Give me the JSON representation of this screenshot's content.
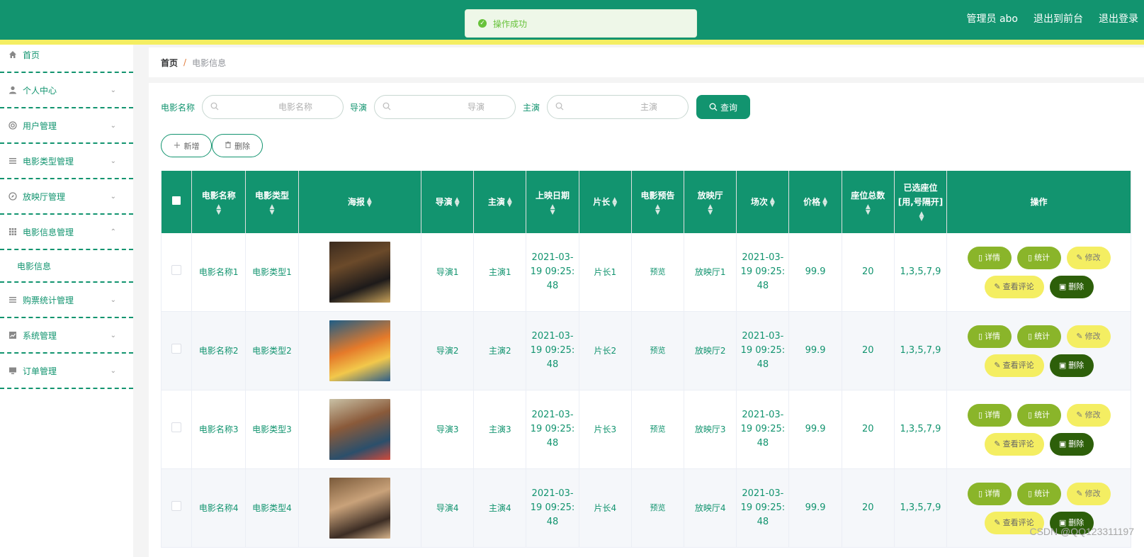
{
  "header": {
    "admin_label": "管理员 abo",
    "to_frontend": "退出到前台",
    "logout": "退出登录",
    "toast": "操作成功"
  },
  "sidebar": {
    "items": [
      {
        "label": "首页",
        "icon": "home-icon"
      },
      {
        "label": "个人中心",
        "icon": "user-icon"
      },
      {
        "label": "用户管理",
        "icon": "lifebuoy-icon"
      },
      {
        "label": "电影类型管理",
        "icon": "list-icon"
      },
      {
        "label": "放映厅管理",
        "icon": "compass-icon"
      },
      {
        "label": "电影信息管理",
        "icon": "grid-icon"
      },
      {
        "label": "购票统计管理",
        "icon": "list-icon"
      },
      {
        "label": "系统管理",
        "icon": "chart-icon"
      },
      {
        "label": "订单管理",
        "icon": "monitor-icon"
      }
    ],
    "submenu_item": "电影信息"
  },
  "breadcrumb": {
    "home": "首页",
    "sep": "/",
    "current": "电影信息"
  },
  "search": {
    "name_label": "电影名称",
    "name_placeholder": "电影名称",
    "director_label": "导演",
    "director_placeholder": "导演",
    "actor_label": "主演",
    "actor_placeholder": "主演",
    "query_button": "查询"
  },
  "actions": {
    "add": "新增",
    "delete": "删除"
  },
  "table": {
    "headers": [
      "电影名称",
      "电影类型",
      "海报",
      "导演",
      "主演",
      "上映日期",
      "片长",
      "电影预告",
      "放映厅",
      "场次",
      "价格",
      "座位总数",
      "已选座位[用,号隔开]",
      "操作"
    ],
    "rows": [
      {
        "name": "电影名称1",
        "type": "电影类型1",
        "director": "导演1",
        "actor": "主演1",
        "release": "2021-03-19 09:25:48",
        "length": "片长1",
        "trailer": "预览",
        "hall": "放映厅1",
        "session": "2021-03-19 09:25:48",
        "price": "99.9",
        "seats": "20",
        "selected": "1,3,5,7,9"
      },
      {
        "name": "电影名称2",
        "type": "电影类型2",
        "director": "导演2",
        "actor": "主演2",
        "release": "2021-03-19 09:25:48",
        "length": "片长2",
        "trailer": "预览",
        "hall": "放映厅2",
        "session": "2021-03-19 09:25:48",
        "price": "99.9",
        "seats": "20",
        "selected": "1,3,5,7,9"
      },
      {
        "name": "电影名称3",
        "type": "电影类型3",
        "director": "导演3",
        "actor": "主演3",
        "release": "2021-03-19 09:25:48",
        "length": "片长3",
        "trailer": "预览",
        "hall": "放映厅3",
        "session": "2021-03-19 09:25:48",
        "price": "99.9",
        "seats": "20",
        "selected": "1,3,5,7,9"
      },
      {
        "name": "电影名称4",
        "type": "电影类型4",
        "director": "导演4",
        "actor": "主演4",
        "release": "2021-03-19 09:25:48",
        "length": "片长4",
        "trailer": "预览",
        "hall": "放映厅4",
        "session": "2021-03-19 09:25:48",
        "price": "99.9",
        "seats": "20",
        "selected": "1,3,5,7,9"
      }
    ],
    "ops": {
      "detail": "详情",
      "stats": "统计",
      "edit": "修改",
      "review": "查看评论",
      "delete": "删除"
    }
  },
  "watermark": "CSDN @QQ123311197",
  "colors": {
    "primary": "#12946f",
    "accent_yellow": "#f4ee62",
    "olive": "#8ab52a",
    "dark_green": "#2d5f0a"
  }
}
